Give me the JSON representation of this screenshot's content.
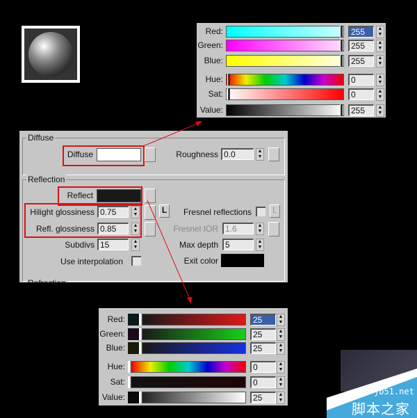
{
  "top_picker": {
    "rows": [
      {
        "label": "Red:",
        "value": "255",
        "selected": true,
        "bar": "linear-gradient(90deg,#00ffff,#ccffff)"
      },
      {
        "label": "Green:",
        "value": "255",
        "bar": "linear-gradient(90deg,#ff00ff,#ffe0ff)"
      },
      {
        "label": "Blue:",
        "value": "255",
        "bar": "linear-gradient(90deg,#ffff00,#ffffe0)"
      },
      {
        "label": "Hue:",
        "value": "0",
        "bar": "linear-gradient(90deg,#e00,#ee0,#0c0,#0cc,#00c,#c0c,#e00)"
      },
      {
        "label": "Sat:",
        "value": "0",
        "bar": "linear-gradient(90deg,#fff,#ff0000)"
      },
      {
        "label": "Value:",
        "value": "255",
        "bar": "linear-gradient(90deg,#000,#fff)"
      }
    ]
  },
  "bottom_picker": {
    "rows": [
      {
        "label": "Red:",
        "value": "25",
        "selected": true,
        "swatch": "#0a1a1a",
        "bar": "linear-gradient(90deg,#191919,#e01818)"
      },
      {
        "label": "Green:",
        "value": "25",
        "swatch": "#1a0a1a",
        "bar": "linear-gradient(90deg,#191919,#18d018)"
      },
      {
        "label": "Blue:",
        "value": "25",
        "swatch": "#1a1a0a",
        "bar": "linear-gradient(90deg,#191919,#1830e0)"
      },
      {
        "label": "Hue:",
        "value": "0",
        "swatch": "",
        "bar": "linear-gradient(90deg,#e00,#ee0,#0c0,#0cc,#00c,#c0c,#e00)"
      },
      {
        "label": "Sat:",
        "value": "0",
        "swatch": "",
        "bar": "linear-gradient(90deg,#111,#200505)"
      },
      {
        "label": "Value:",
        "value": "25",
        "swatch": "#0a0a0a",
        "bar": "linear-gradient(90deg,#222,#fff)"
      }
    ]
  },
  "material": {
    "diffuse_group": "Diffuse",
    "diffuse_label": "Diffuse",
    "roughness_label": "Roughness",
    "roughness_value": "0.0",
    "reflection_group": "Reflection",
    "reflect_label": "Reflect",
    "hilight_label": "Hilight glossiness",
    "hilight_value": "0.75",
    "refl_gloss_label": "Refl. glossiness",
    "refl_gloss_value": "0.85",
    "subdivs_label": "Subdivs",
    "subdivs_value": "15",
    "use_interp_label": "Use interpolation",
    "lock_label": "L",
    "fresnel_label": "Fresnel reflections",
    "fresnel_lock": "L",
    "fresnel_ior_label": "Fresnel IOR",
    "fresnel_ior_value": "1.6",
    "max_depth_label": "Max depth",
    "max_depth_value": "5",
    "exit_color_label": "Exit color",
    "refraction_group": "Refraction"
  },
  "colors": {
    "accent_red": "#dd1111",
    "diffuse": "#ffffff",
    "reflect": "#191919",
    "exit": "#000000"
  },
  "watermark": {
    "url": "jb51.net",
    "name": "脚本之家"
  }
}
